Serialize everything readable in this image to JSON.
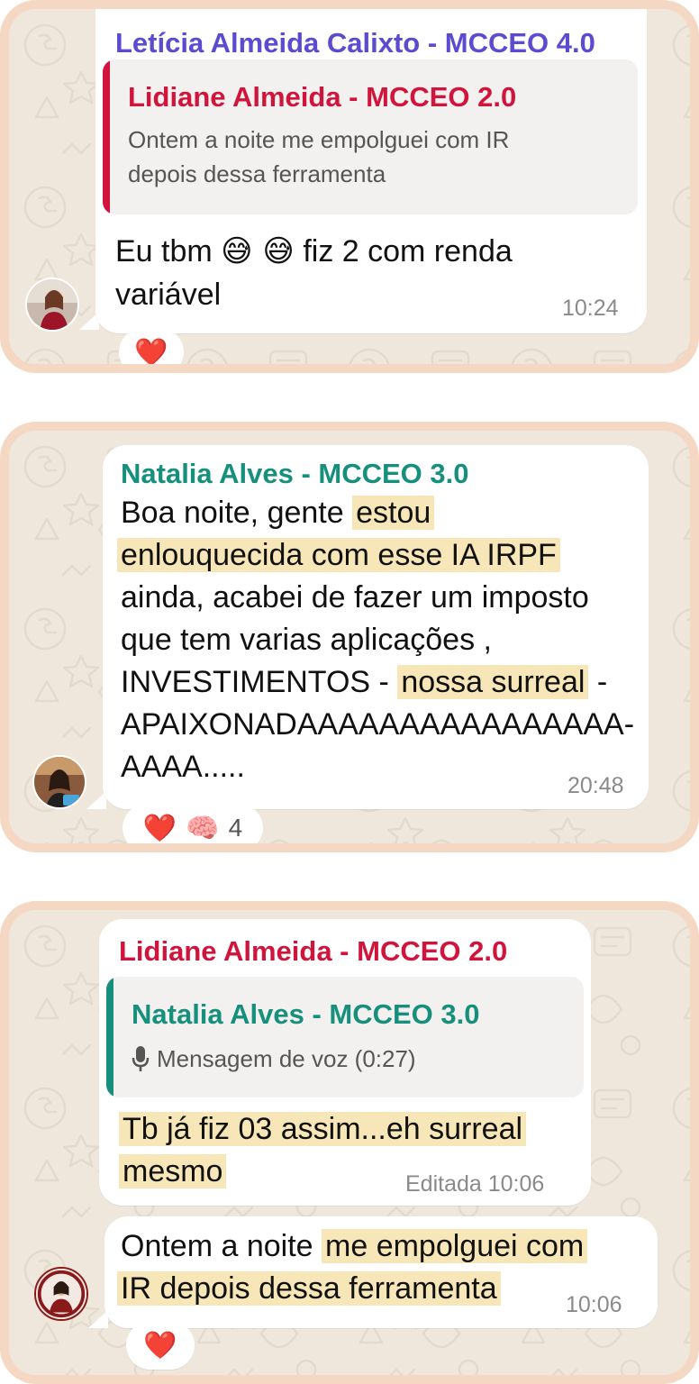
{
  "colors": {
    "card_border": "#f5d8c3",
    "chat_background": "#efe7dc",
    "highlight": "#f6e6b8",
    "leticia": "#5b4bd1",
    "lidiane": "#d0143c",
    "natalia": "#16907d"
  },
  "card1": {
    "sender": "Letícia Almeida Calixto - MCCEO 4.0",
    "quote": {
      "sender": "Lidiane Almeida - MCCEO 2.0",
      "line1": "Ontem a noite me empolguei com IR",
      "line2": "depois dessa ferramenta"
    },
    "text_before": "Eu tbm",
    "emojis": "😅 😅",
    "text_after": "fiz 2 com renda",
    "text_line2": "variável",
    "time": "10:24",
    "reaction": "❤️"
  },
  "card2": {
    "sender": "Natalia Alves - MCCEO 3.0",
    "line1_plain": "Boa noite, gente",
    "line1_hl": "estou",
    "line2_hl": "enlouquecida com esse IA IRPF",
    "line3": "ainda, acabei de fazer um imposto",
    "line4": "que tem varias aplicações ,",
    "line5_plain": "INVESTIMENTOS -",
    "line5_hl": "nossa surreal",
    "line5_end": "-",
    "line6": "APAIXONADAAAAAAAAAAAAAAAA-",
    "line7": "AAAA.....",
    "time": "20:48",
    "reactions": [
      "❤️",
      "🧠"
    ],
    "reaction_count": "4"
  },
  "card3": {
    "bubble1": {
      "sender": "Lidiane Almeida - MCCEO 2.0",
      "quote": {
        "sender": "Natalia Alves - MCCEO 3.0",
        "voice_label": "Mensagem de voz (0:27)"
      },
      "line1": "Tb já fiz 03 assim...eh surreal",
      "line2": "mesmo",
      "edited_time": "Editada 10:06"
    },
    "bubble2": {
      "line1_plain": "Ontem a noite",
      "line1_hl": "me empolguei com",
      "line2_hl": "IR depois dessa ferramenta",
      "time": "10:06"
    },
    "reaction": "❤️"
  }
}
